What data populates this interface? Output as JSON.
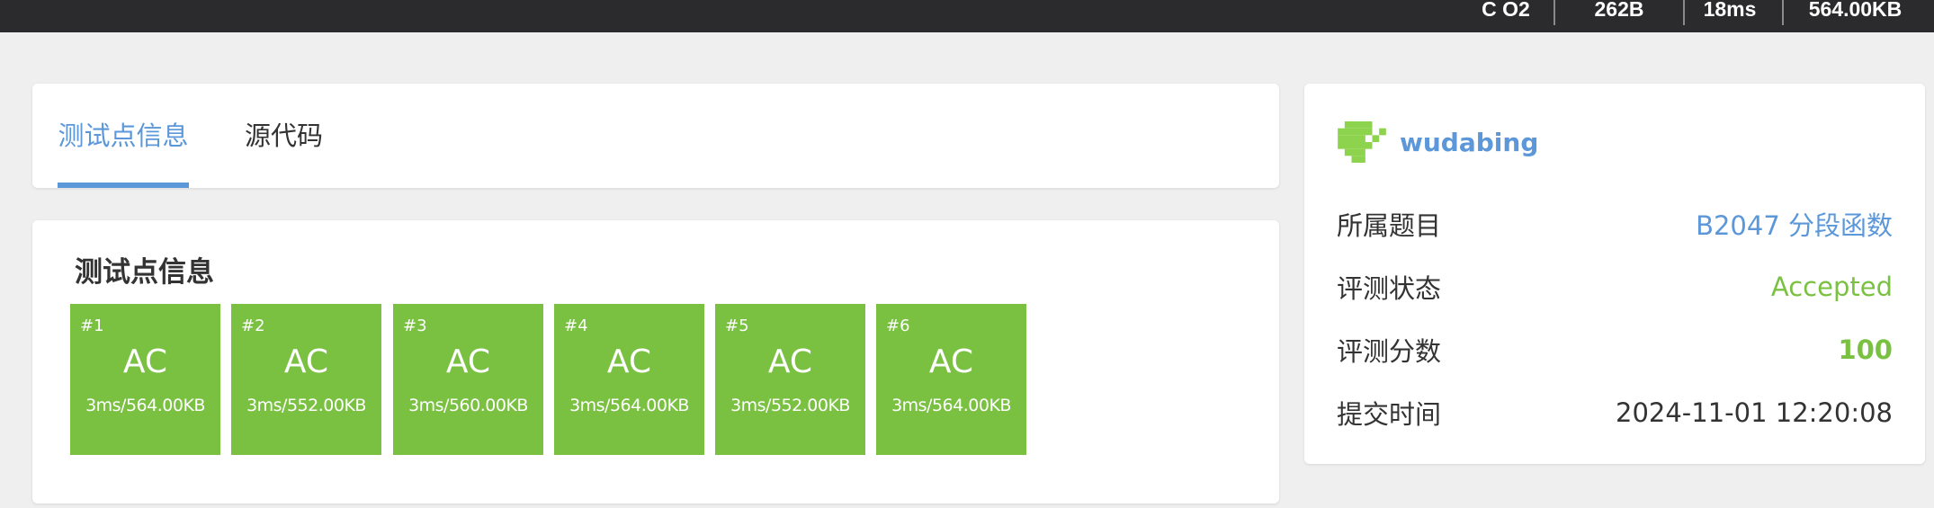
{
  "topbar": {
    "language": "C O2",
    "code_length": "262B",
    "time": "18ms",
    "memory": "564.00KB"
  },
  "tabs": [
    {
      "label": "测试点信息",
      "active": true
    },
    {
      "label": "源代码",
      "active": false
    }
  ],
  "testcases": {
    "title": "测试点信息",
    "items": [
      {
        "num": "#1",
        "result": "AC",
        "detail": "3ms/564.00KB"
      },
      {
        "num": "#2",
        "result": "AC",
        "detail": "3ms/552.00KB"
      },
      {
        "num": "#3",
        "result": "AC",
        "detail": "3ms/560.00KB"
      },
      {
        "num": "#4",
        "result": "AC",
        "detail": "3ms/564.00KB"
      },
      {
        "num": "#5",
        "result": "AC",
        "detail": "3ms/552.00KB"
      },
      {
        "num": "#6",
        "result": "AC",
        "detail": "3ms/564.00KB"
      }
    ]
  },
  "info": {
    "username": "wudabing",
    "rows": [
      {
        "label": "所属题目",
        "value": "B2047 分段函数"
      },
      {
        "label": "评测状态",
        "value": "Accepted"
      },
      {
        "label": "评测分数",
        "value": "100"
      },
      {
        "label": "提交时间",
        "value": "2024-11-01 12:20:08"
      }
    ]
  },
  "colors": {
    "accent_blue": "#5b97d9",
    "ac_green": "#7ac142",
    "topbar_bg": "#2b2b2d",
    "page_bg": "#efefef",
    "avatar_green": "#8ed34e"
  },
  "icons": {
    "avatar": "identicon-avatar"
  }
}
